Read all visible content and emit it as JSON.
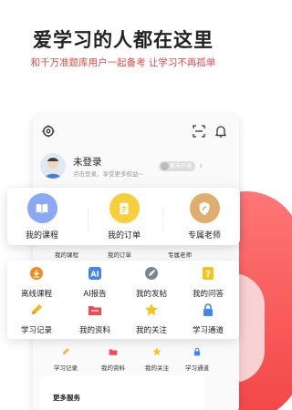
{
  "promo": {
    "headline": "爱学习的人都在这里",
    "subline": "和千万准题库用户一起备考 让学习不再孤单"
  },
  "profile": {
    "title": "未登录",
    "subtitle": "点击登录，享受更多权益~",
    "badge": "暂未开通"
  },
  "main_shortcuts": [
    {
      "label": "我的课程",
      "icon": "book-icon",
      "color": "#6b8ef0"
    },
    {
      "label": "我的订单",
      "icon": "order-icon",
      "color": "#f5c31e"
    },
    {
      "label": "专属老师",
      "icon": "teacher-icon",
      "color": "#d7a05e"
    }
  ],
  "main_shortcuts_small": [
    "我的课程",
    "我的订单",
    "专属老师"
  ],
  "grid": [
    {
      "label": "离线课程",
      "icon": "download-icon",
      "color": "#f58a1f"
    },
    {
      "label": "AI报告",
      "icon": "ai-icon",
      "color": "#3f86f0"
    },
    {
      "label": "我的发帖",
      "icon": "post-icon",
      "color": "#7b8590"
    },
    {
      "label": "我的问答",
      "icon": "question-icon",
      "color": "#f5c31e"
    },
    {
      "label": "学习记录",
      "icon": "pencil-icon",
      "color": "#f5b51e"
    },
    {
      "label": "我的资料",
      "icon": "folder-icon",
      "color": "#ef4b55"
    },
    {
      "label": "我的关注",
      "icon": "star-icon",
      "color": "#f5c31e"
    },
    {
      "label": "学习通道",
      "icon": "lock-icon",
      "color": "#3f86f0"
    }
  ],
  "grid_small": [
    "学习记录",
    "我的资料",
    "我的关注",
    "学习通道"
  ],
  "more": {
    "title": "更多服务"
  }
}
